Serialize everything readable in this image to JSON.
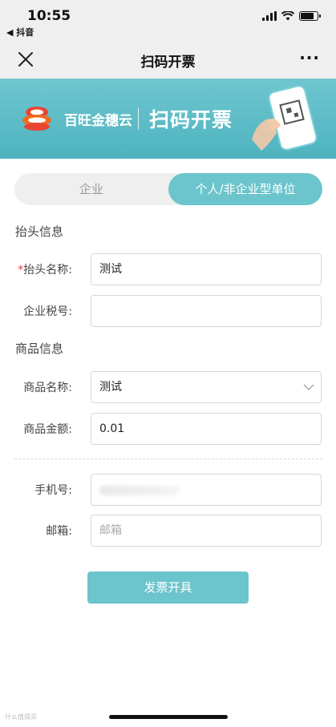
{
  "status_bar": {
    "time": "10:55",
    "back_app": "◀ 抖音"
  },
  "nav": {
    "title": "扫码开票",
    "more": "···"
  },
  "banner": {
    "brand": "百旺金穗云",
    "title": "扫码开票"
  },
  "tabs": [
    {
      "label": "企业",
      "active": false
    },
    {
      "label": "个人/非企业型单位",
      "active": true
    }
  ],
  "header_section": {
    "title": "抬头信息",
    "name_label": "抬头名称:",
    "name_required_mark": "*",
    "name_value": "测试",
    "tax_label": "企业税号:",
    "tax_value": ""
  },
  "goods_section": {
    "title": "商品信息",
    "name_label": "商品名称:",
    "name_value": "测试",
    "amount_label": "商品金额:",
    "amount_value": "0.01"
  },
  "contact_section": {
    "phone_label": "手机号:",
    "email_label": "邮箱:",
    "email_placeholder": "邮箱"
  },
  "submit_label": "发票开具",
  "watermark": "什么值得买",
  "colors": {
    "accent": "#6cc4cc",
    "banner": "#5ab9c4",
    "required": "#e03c3c"
  }
}
